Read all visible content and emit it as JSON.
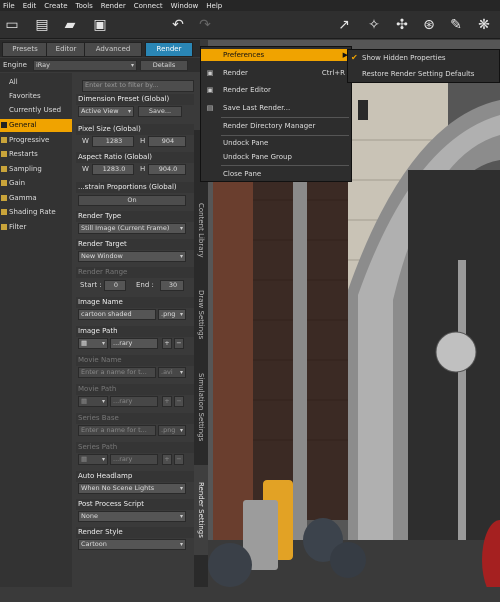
{
  "menubar": {
    "items": [
      "File",
      "Edit",
      "Create",
      "Tools",
      "Render",
      "Connect",
      "Window",
      "Help"
    ]
  },
  "toolbar": {
    "icons": [
      "new-file-icon",
      "save-icon",
      "open-icon",
      "save-as-icon",
      "undo-icon",
      "redo-icon",
      "perspective-view-icon",
      "transform-icon",
      "node-weight-icon",
      "joint-editor-icon",
      "surface-selection-icon",
      "render-settings-icon"
    ]
  },
  "tabs": [
    "Presets",
    "Editor",
    "Advanced",
    "Render"
  ],
  "filter": {
    "engine_label": "Engine",
    "engine_value": "iRay",
    "details_label": "Details",
    "search_placeholder": "Enter text to filter by..."
  },
  "left_list": [
    "All",
    "Favorites",
    "Currently Used",
    "General",
    "Progressive",
    "Restarts",
    "Sampling",
    "Gain",
    "Gamma",
    "Shading Rate",
    "Filter"
  ],
  "settings": {
    "dimension_preset": "Dimension Preset (Global)",
    "active_view": "Active View",
    "save": "Save...",
    "pixel_size": "Pixel Size (Global)",
    "w_label": "W",
    "w_value": "1283",
    "h_label": "H",
    "h_value": "904",
    "aspect_ratio": "Aspect Ratio (Global)",
    "ar_w": "1283.0",
    "ar_h": "904.0",
    "constrain": "...strain Proportions (Global)",
    "on": "On",
    "render_type": "Render Type",
    "render_type_value": "Still Image (Current Frame)",
    "render_target": "Render Target",
    "render_target_value": "New Window",
    "render_range": "Render Range",
    "start_label": "Start :",
    "start_value": "0",
    "end_label": "End :",
    "end_value": "30",
    "image_name": "Image Name",
    "image_name_value": "cartoon shaded",
    "image_ext": ".png",
    "image_path": "Image Path",
    "browse": "...rary",
    "movie_name": "Movie Name",
    "movie_placeholder": "Enter a name for t...",
    "movie_ext": ".avi",
    "movie_path": "Movie Path",
    "series_base": "Series Base",
    "series_placeholder": "Enter a name for t...",
    "series_ext": ".png",
    "series_path": "Series Path",
    "auto_headlamp": "Auto Headlamp",
    "auto_headlamp_value": "When No Scene Lights",
    "post_process": "Post Process Script",
    "post_process_value": "None",
    "render_style": "Render Style",
    "render_style_value": "Cartoon"
  },
  "side_tabs": [
    "Content Library",
    "Draw Settings",
    "Simulation Settings",
    "Render Settings"
  ],
  "menu_main": {
    "items": [
      {
        "label": "Preferences",
        "shortcut": "",
        "highlighted": true,
        "icon": "preferences-icon"
      },
      {
        "label": "Render",
        "shortcut": "Ctrl+R",
        "highlighted": false,
        "icon": "render-icon"
      },
      {
        "label": "Render Editor",
        "shortcut": "",
        "highlighted": false,
        "icon": "render-editor-icon"
      },
      {
        "label": "Save Last Render...",
        "shortcut": "",
        "highlighted": false,
        "icon": "save-render-icon"
      },
      {
        "label": "Render Directory Manager",
        "shortcut": "",
        "highlighted": false,
        "icon": ""
      },
      {
        "label": "Undock Pane",
        "shortcut": "",
        "highlighted": false,
        "icon": ""
      },
      {
        "label": "Undock Pane Group",
        "shortcut": "",
        "highlighted": false,
        "icon": ""
      },
      {
        "label": "Close Pane",
        "shortcut": "",
        "highlighted": false,
        "icon": ""
      }
    ]
  },
  "menu_sub": {
    "items": [
      {
        "label": "Show Hidden Properties",
        "checked": true
      },
      {
        "label": "Restore Render Setting Defaults",
        "checked": false
      }
    ]
  },
  "colors": {
    "accent": "#f0a300",
    "tab_active": "#2a86b5"
  }
}
